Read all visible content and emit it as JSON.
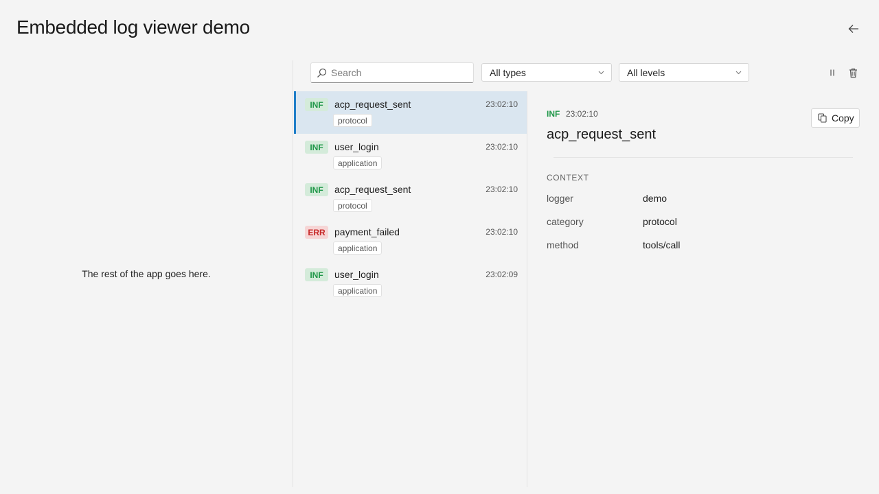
{
  "header": {
    "title": "Embedded log viewer demo",
    "back_icon": "arrow-left-icon"
  },
  "left_pane": {
    "text": "The rest of the app goes here."
  },
  "toolbar": {
    "search": {
      "placeholder": "Search",
      "value": "",
      "icon": "search-icon"
    },
    "type_filter": {
      "value": "All types"
    },
    "level_filter": {
      "value": "All levels"
    },
    "pause_icon": "pause-icon",
    "clear_icon": "trash-icon"
  },
  "colors": {
    "accent": "#1e7ec8",
    "selected_row": "#dae6f0",
    "info": "#1f9748",
    "error": "#c62828"
  },
  "logs": [
    {
      "level": "INF",
      "name": "acp_request_sent",
      "time": "23:02:10",
      "category": "protocol",
      "selected": true
    },
    {
      "level": "INF",
      "name": "user_login",
      "time": "23:02:10",
      "category": "application",
      "selected": false
    },
    {
      "level": "INF",
      "name": "acp_request_sent",
      "time": "23:02:10",
      "category": "protocol",
      "selected": false
    },
    {
      "level": "ERR",
      "name": "payment_failed",
      "time": "23:02:10",
      "category": "application",
      "selected": false
    },
    {
      "level": "INF",
      "name": "user_login",
      "time": "23:02:09",
      "category": "application",
      "selected": false
    }
  ],
  "detail": {
    "level": "INF",
    "time": "23:02:10",
    "name": "acp_request_sent",
    "copy_label": "Copy",
    "copy_icon": "copy-icon",
    "section_label": "CONTEXT",
    "context": [
      {
        "key": "logger",
        "value": "demo"
      },
      {
        "key": "category",
        "value": "protocol"
      },
      {
        "key": "method",
        "value": "tools/call"
      }
    ]
  }
}
